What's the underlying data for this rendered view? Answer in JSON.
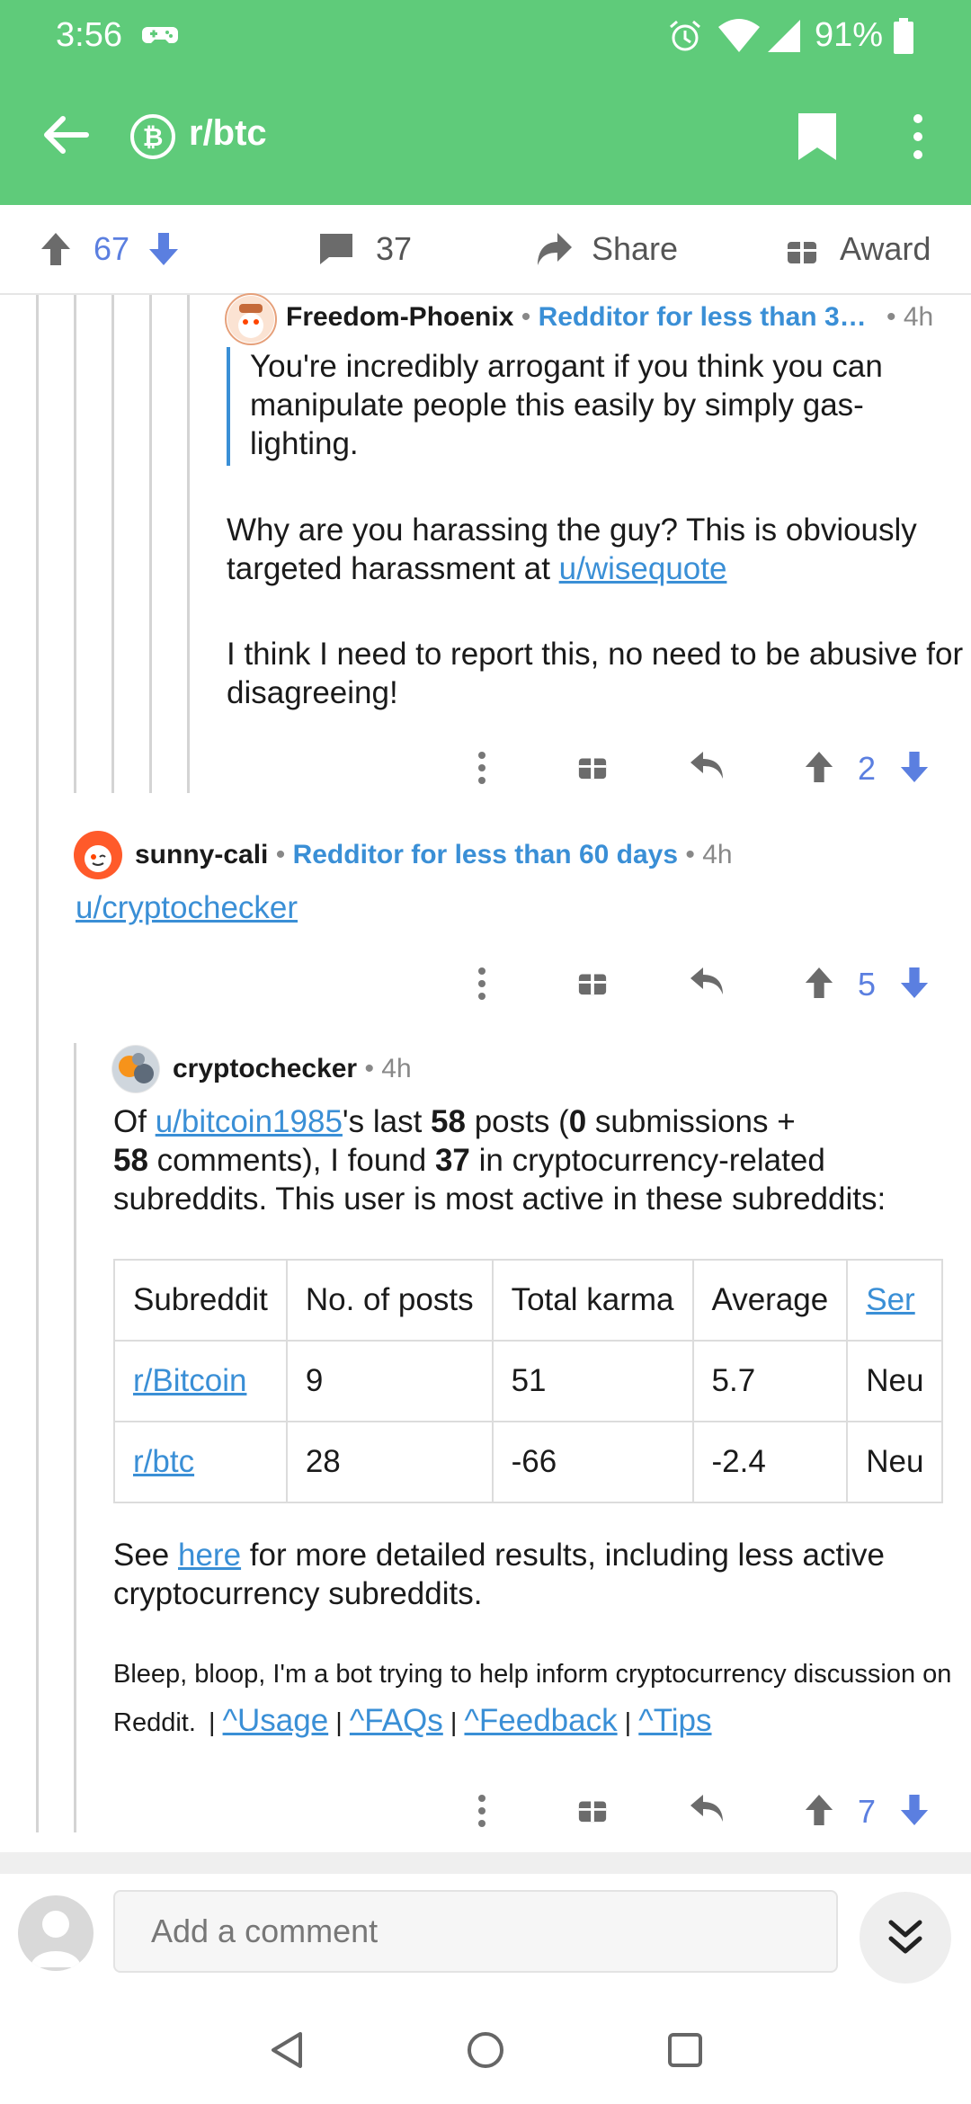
{
  "status_bar": {
    "time": "3:56",
    "battery": "91%"
  },
  "app_bar": {
    "subreddit": "r/btc"
  },
  "post_actions": {
    "score": "67",
    "comments": "37",
    "share_label": "Share",
    "award_label": "Award"
  },
  "comments": [
    {
      "user": "Freedom-Phoenix",
      "flair": "Redditor for less than 3…",
      "age": "• 4h",
      "quote": "You're incredibly arrogant if you think you can manipulate people this easily by simply gas-lighting.",
      "para1_text": "Why are you harassing the guy? This is obviously targeted harassment at ",
      "para1_link": "u/wisequote",
      "para2": "I think I need to report this, no need to be abusive for disagreeing!",
      "score": "2"
    },
    {
      "user": "sunny-cali",
      "flair": "Redditor for less than 60 days",
      "age": "• 4h",
      "link": "u/cryptochecker",
      "score": "5"
    },
    {
      "user": "cryptochecker",
      "age": "• 4h",
      "intro_of": "Of ",
      "intro_link": "u/bitcoin1985",
      "intro_a": "'s last ",
      "intro_n1": "58",
      "intro_b": " posts (",
      "intro_n2": "0",
      "intro_c": " submissions +",
      "intro_n3": "58",
      "intro_d": " comments), I found ",
      "intro_n4": "37",
      "intro_e": " in cryptocurrency-related",
      "intro_f": "subreddits. This user is most active in these subreddits:",
      "table": {
        "headers": [
          "Subreddit",
          "No. of posts",
          "Total karma",
          "Average",
          "Ser"
        ],
        "rows": [
          [
            "r/Bitcoin",
            "9",
            "51",
            "5.7",
            "Neu"
          ],
          [
            "r/btc",
            "28",
            "-66",
            "-2.4",
            "Neu"
          ]
        ]
      },
      "see_prefix": "See ",
      "see_link": "here",
      "see_suffix": " for more detailed results, including less active",
      "see_line2": "cryptocurrency subreddits.",
      "bot_line1": "Bleep, bloop, I'm a bot trying to help inform cryptocurrency discussion on",
      "bot_line2": "Reddit.",
      "footer_links": [
        "^Usage",
        "^FAQs",
        "^Feedback",
        "^Tips"
      ],
      "score": "7"
    }
  ],
  "composer": {
    "placeholder": "Add a comment"
  },
  "colors": {
    "app_bar": "#5fcb7a",
    "link": "#3a8fd6",
    "vote": "#5b7fe0"
  }
}
